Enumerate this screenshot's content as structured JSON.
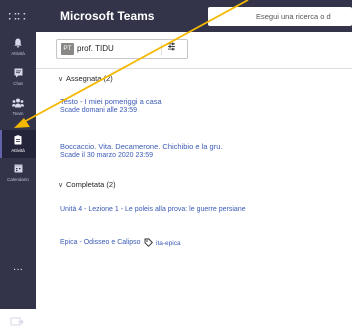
{
  "topbar": {
    "app_title": "Microsoft Teams",
    "search_placeholder": "Esegui una ricerca o d"
  },
  "rail": {
    "items": [
      {
        "label": "Attività",
        "icon": "bell-icon"
      },
      {
        "label": "Chat",
        "icon": "chat-icon"
      },
      {
        "label": "Team",
        "icon": "team-icon"
      },
      {
        "label": "Attività",
        "icon": "assignments-icon"
      },
      {
        "label": "Calendario",
        "icon": "calendar-icon"
      }
    ],
    "more": "···",
    "active_index": 3
  },
  "class_chip": {
    "avatar": "PT",
    "name": "prof. TIDU"
  },
  "assigned": {
    "header": "Assegnata (2)",
    "tasks": [
      {
        "title": "Testo - I miei pomeriggi a casa",
        "due": "Scade domani alle 23:59"
      },
      {
        "title": "Boccaccio. Vita. Decamerone. Chichibio e la gru.",
        "due": "Scade il 30 marzo 2020 23:59"
      }
    ]
  },
  "completed": {
    "header": "Completata (2)",
    "items": [
      {
        "title": "Unità 4 - Lezione 1 - Le poleis alla prova: le guerre persiane"
      },
      {
        "title": "Epica - Odisseo e Calipso",
        "tag": "ita-epica"
      }
    ]
  },
  "colors": {
    "rail": "#33344a",
    "link": "#3b5bb5",
    "annotation_arrow": "#f5b800"
  }
}
